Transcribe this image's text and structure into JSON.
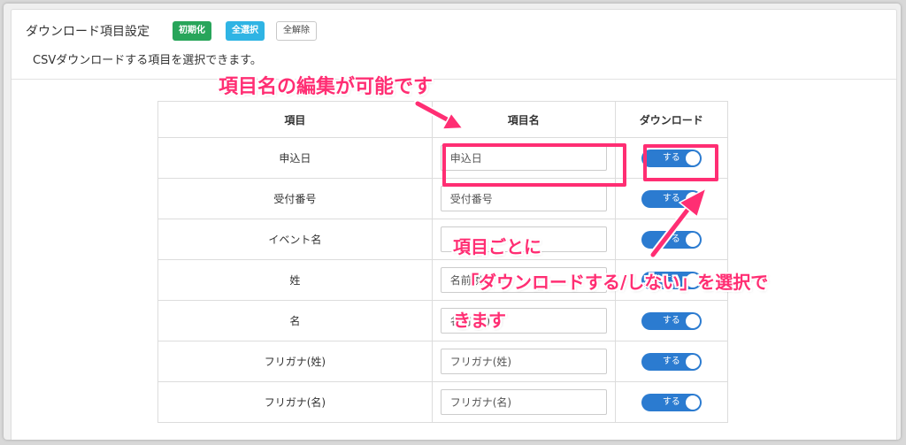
{
  "header": {
    "title": "ダウンロード項目設定",
    "buttons": {
      "reset": "初期化",
      "select_all": "全選択",
      "deselect_all": "全解除"
    },
    "description": "CSVダウンロードする項目を選択できます。"
  },
  "table": {
    "columns": [
      "項目",
      "項目名",
      "ダウンロード"
    ],
    "rows": [
      {
        "item": "申込日",
        "name": "申込日",
        "toggle": "する"
      },
      {
        "item": "受付番号",
        "name": "受付番号",
        "toggle": "する"
      },
      {
        "item": "イベント名",
        "name": "",
        "toggle": "する"
      },
      {
        "item": "姓",
        "name": "名前(姓)",
        "toggle": "する"
      },
      {
        "item": "名",
        "name": "名前(名)",
        "toggle": "する"
      },
      {
        "item": "フリガナ(姓)",
        "name": "フリガナ(姓)",
        "toggle": "する"
      },
      {
        "item": "フリガナ(名)",
        "name": "フリガナ(名)",
        "toggle": "する"
      }
    ]
  },
  "annotations": {
    "edit_note": "項目名の編集が可能です",
    "toggle_note_line1": "項目ごとに",
    "toggle_note_line2": "「ダウンロードする/しない」を選択で",
    "toggle_note_line3": "きます"
  },
  "colors": {
    "accent_pink": "#ff2e73",
    "toggle_on": "#2b7bd0",
    "reset_button": "#28a55a",
    "select_all_button": "#2fb4e4"
  }
}
